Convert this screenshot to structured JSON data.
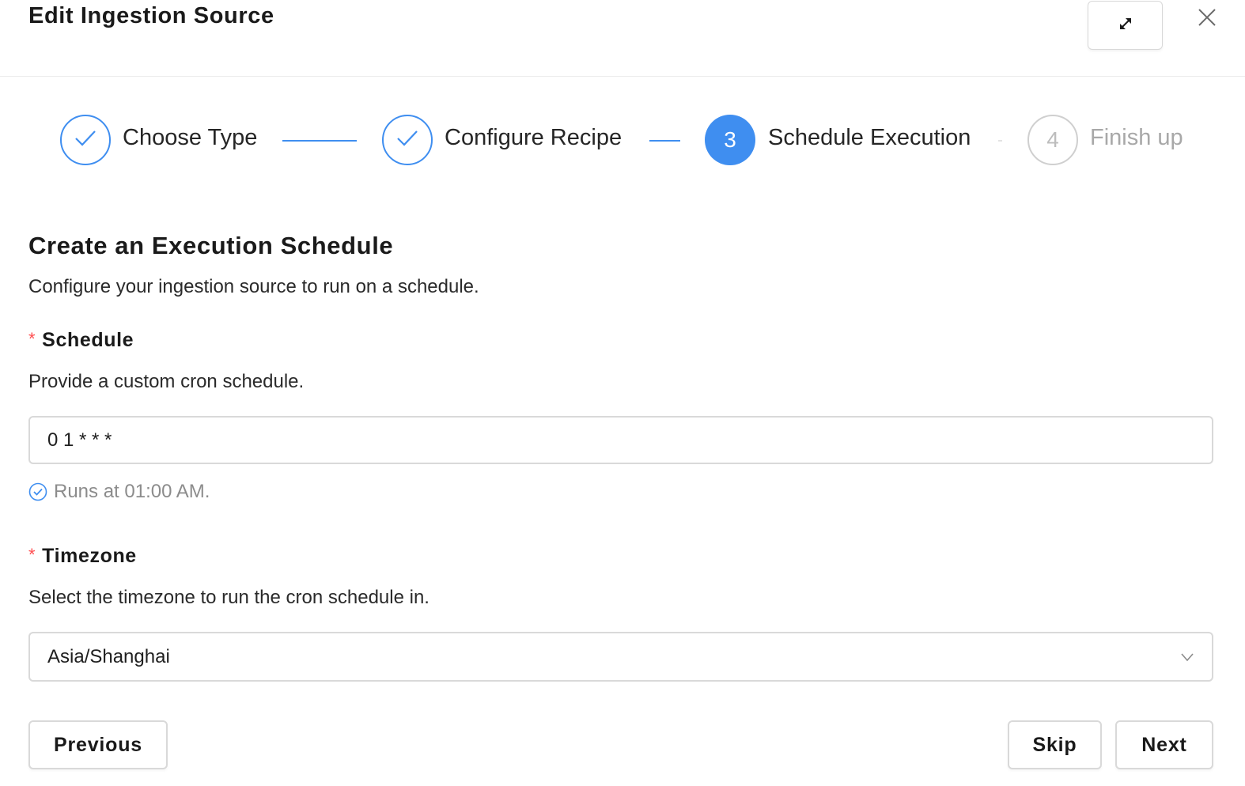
{
  "modal": {
    "title": "Edit Ingestion Source",
    "expand_icon": "expand-arrows-icon",
    "close_icon": "close-icon"
  },
  "steps": [
    {
      "label": "Choose Type",
      "status": "done",
      "icon": "check-icon"
    },
    {
      "label": "Configure Recipe",
      "status": "done",
      "icon": "check-icon"
    },
    {
      "label": "Schedule Execution",
      "status": "active",
      "number": "3"
    },
    {
      "label": "Finish up",
      "status": "wait",
      "number": "4"
    }
  ],
  "section": {
    "title": "Create an Execution Schedule",
    "description": "Configure your ingestion source to run on a schedule."
  },
  "schedule": {
    "required_mark": "*",
    "label": "Schedule",
    "help": "Provide a custom cron schedule.",
    "value": "0 1 * * *",
    "hint": "Runs at 01:00 AM.",
    "hint_icon": "check-circle-icon"
  },
  "timezone": {
    "required_mark": "*",
    "label": "Timezone",
    "help": "Select the timezone to run the cron schedule in.",
    "value": "Asia/Shanghai",
    "arrow_icon": "chevron-down-icon"
  },
  "footer": {
    "previous_label": "Previous",
    "skip_label": "Skip",
    "next_label": "Next"
  },
  "colors": {
    "primary": "#3f8ef0",
    "required": "#ff4d4f",
    "border": "#d9d9d9",
    "muted": "#8c8c8c"
  }
}
